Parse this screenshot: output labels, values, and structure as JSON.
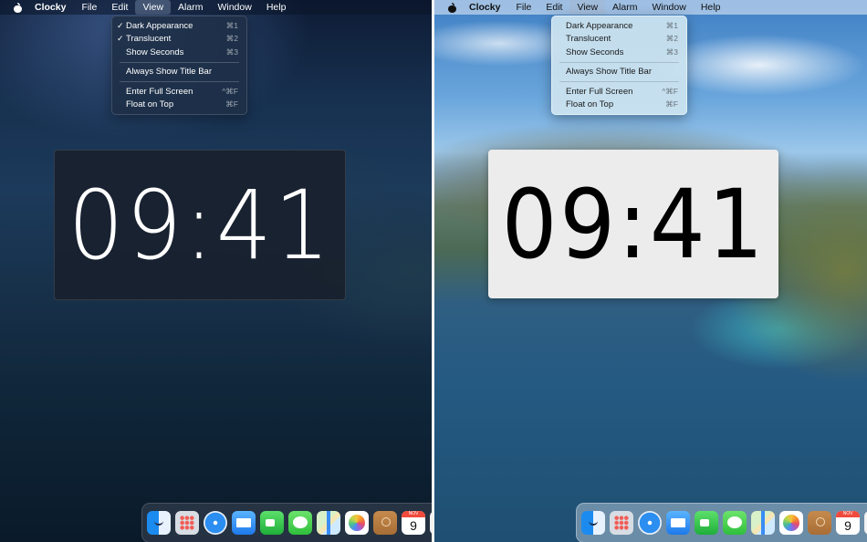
{
  "menubar": {
    "app_name": "Clocky",
    "items": [
      "File",
      "Edit",
      "View",
      "Alarm",
      "Window",
      "Help"
    ],
    "active_item": "View"
  },
  "view_menu": {
    "items": [
      {
        "label": "Dark Appearance",
        "shortcut": "⌘1"
      },
      {
        "label": "Translucent",
        "shortcut": "⌘2"
      },
      {
        "label": "Show Seconds",
        "shortcut": "⌘3"
      },
      {
        "label": "Always Show Title Bar",
        "shortcut": ""
      },
      {
        "label": "Enter Full Screen",
        "shortcut": "^⌘F"
      },
      {
        "label": "Float on Top",
        "shortcut": "⌘F"
      }
    ],
    "check_glyph": "✓"
  },
  "screens": [
    {
      "theme": "dark",
      "checked": [
        "Dark Appearance",
        "Translucent"
      ]
    },
    {
      "theme": "light",
      "checked": []
    }
  ],
  "clock": {
    "time": "09:41"
  },
  "dock": {
    "icons": [
      "finder-icon",
      "launchpad-icon",
      "safari-icon",
      "mail-icon",
      "facetime-icon",
      "messages-icon",
      "maps-icon",
      "photos-icon",
      "contacts-icon",
      "calendar-icon"
    ],
    "calendar": {
      "month": "NOV",
      "day": "9"
    }
  },
  "colors": {
    "dark_clock_bg": "#1e2230",
    "light_clock_bg": "#ececec"
  }
}
